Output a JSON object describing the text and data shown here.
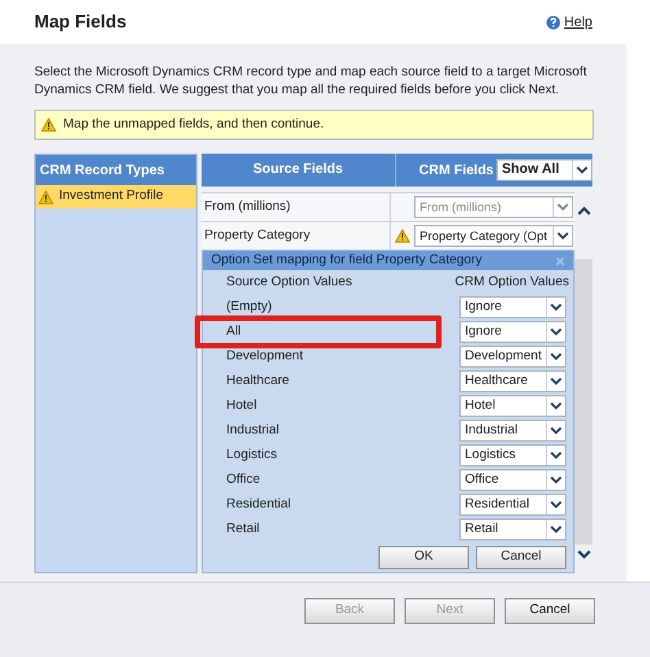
{
  "header": {
    "title": "Map Fields",
    "help": "Help"
  },
  "instructions": "Select the Microsoft Dynamics CRM record type and map each source field to a target Microsoft Dynamics CRM field. We suggest that you map all the required fields before you click Next.",
  "warning": "Map the unmapped fields, and then continue.",
  "record_types": {
    "heading": "CRM Record Types",
    "items": [
      {
        "label": "Investment Profile",
        "selected": true,
        "warning": true
      }
    ]
  },
  "grid": {
    "source_heading": "Source Fields",
    "target_heading": "CRM Fields",
    "filter": "Show All",
    "rows": [
      {
        "source": "From (millions)",
        "target": "From (millions)",
        "disabled": true,
        "warning": false
      },
      {
        "source": "Property Category",
        "target": "Property Category (Opt",
        "disabled": false,
        "warning": true
      }
    ]
  },
  "option_mapping": {
    "title": "Option Set mapping for field Property Category",
    "source_heading": "Source Option Values",
    "target_heading": "CRM Option Values",
    "rows": [
      {
        "source": "(Empty)",
        "target": "Ignore",
        "highlighted": false
      },
      {
        "source": "All",
        "target": "Ignore",
        "highlighted": true
      },
      {
        "source": "Development",
        "target": "Development",
        "highlighted": false
      },
      {
        "source": "Healthcare",
        "target": "Healthcare",
        "highlighted": false
      },
      {
        "source": "Hotel",
        "target": "Hotel",
        "highlighted": false
      },
      {
        "source": "Industrial",
        "target": "Industrial",
        "highlighted": false
      },
      {
        "source": "Logistics",
        "target": "Logistics",
        "highlighted": false
      },
      {
        "source": "Office",
        "target": "Office",
        "highlighted": false
      },
      {
        "source": "Residential",
        "target": "Residential",
        "highlighted": false
      },
      {
        "source": "Retail",
        "target": "Retail",
        "highlighted": false
      }
    ],
    "buttons": [
      "OK",
      "Cancel"
    ]
  },
  "footer": [
    {
      "label": "Back",
      "disabled": true
    },
    {
      "label": "Next",
      "disabled": true
    },
    {
      "label": "Cancel",
      "disabled": false
    }
  ]
}
